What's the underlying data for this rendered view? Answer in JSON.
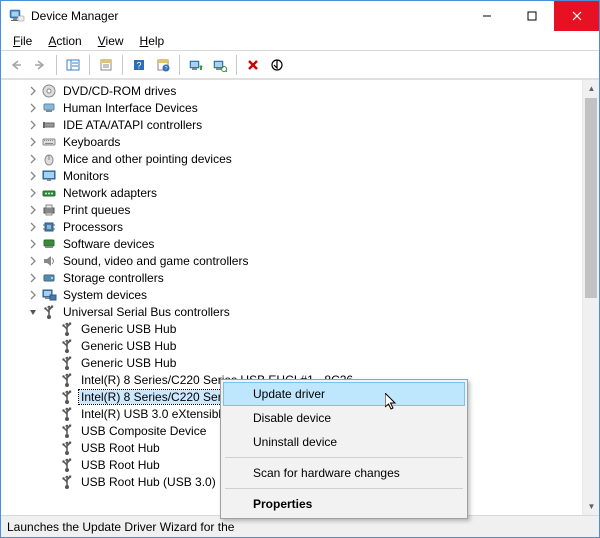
{
  "window": {
    "title": "Device Manager"
  },
  "menubar": {
    "file": "File",
    "action": "Action",
    "view": "View",
    "help": "Help"
  },
  "tree": {
    "nodes": [
      {
        "label": "DVD/CD-ROM drives",
        "icon": "disc",
        "depth": 1,
        "exp": "closed"
      },
      {
        "label": "Human Interface Devices",
        "icon": "hid",
        "depth": 1,
        "exp": "closed"
      },
      {
        "label": "IDE ATA/ATAPI controllers",
        "icon": "ide",
        "depth": 1,
        "exp": "closed"
      },
      {
        "label": "Keyboards",
        "icon": "keyboard",
        "depth": 1,
        "exp": "closed"
      },
      {
        "label": "Mice and other pointing devices",
        "icon": "mouse",
        "depth": 1,
        "exp": "closed"
      },
      {
        "label": "Monitors",
        "icon": "monitor",
        "depth": 1,
        "exp": "closed"
      },
      {
        "label": "Network adapters",
        "icon": "network",
        "depth": 1,
        "exp": "closed"
      },
      {
        "label": "Print queues",
        "icon": "printer",
        "depth": 1,
        "exp": "closed"
      },
      {
        "label": "Processors",
        "icon": "cpu",
        "depth": 1,
        "exp": "closed"
      },
      {
        "label": "Software devices",
        "icon": "software",
        "depth": 1,
        "exp": "closed"
      },
      {
        "label": "Sound, video and game controllers",
        "icon": "sound",
        "depth": 1,
        "exp": "closed"
      },
      {
        "label": "Storage controllers",
        "icon": "storage",
        "depth": 1,
        "exp": "closed"
      },
      {
        "label": "System devices",
        "icon": "system",
        "depth": 1,
        "exp": "closed"
      },
      {
        "label": "Universal Serial Bus controllers",
        "icon": "usb",
        "depth": 1,
        "exp": "open"
      },
      {
        "label": "Generic USB Hub",
        "icon": "usb",
        "depth": 2,
        "exp": "none"
      },
      {
        "label": "Generic USB Hub",
        "icon": "usb",
        "depth": 2,
        "exp": "none"
      },
      {
        "label": "Generic USB Hub",
        "icon": "usb",
        "depth": 2,
        "exp": "none"
      },
      {
        "label": "Intel(R) 8 Series/C220 Series USB EHCI #1 - 8C26",
        "icon": "usb",
        "depth": 2,
        "exp": "none"
      },
      {
        "label": "Intel(R) 8 Series/C220 Serie",
        "icon": "usb",
        "depth": 2,
        "exp": "none",
        "selected": true
      },
      {
        "label": "Intel(R) USB 3.0 eXtensible",
        "icon": "usb",
        "depth": 2,
        "exp": "none"
      },
      {
        "label": "USB Composite Device",
        "icon": "usb",
        "depth": 2,
        "exp": "none"
      },
      {
        "label": "USB Root Hub",
        "icon": "usb",
        "depth": 2,
        "exp": "none"
      },
      {
        "label": "USB Root Hub",
        "icon": "usb",
        "depth": 2,
        "exp": "none"
      },
      {
        "label": "USB Root Hub (USB 3.0)",
        "icon": "usb",
        "depth": 2,
        "exp": "none"
      }
    ]
  },
  "context_menu": {
    "update": "Update driver",
    "disable": "Disable device",
    "uninstall": "Uninstall device",
    "scan": "Scan for hardware changes",
    "properties": "Properties"
  },
  "statusbar": {
    "text": "Launches the Update Driver Wizard for the"
  }
}
